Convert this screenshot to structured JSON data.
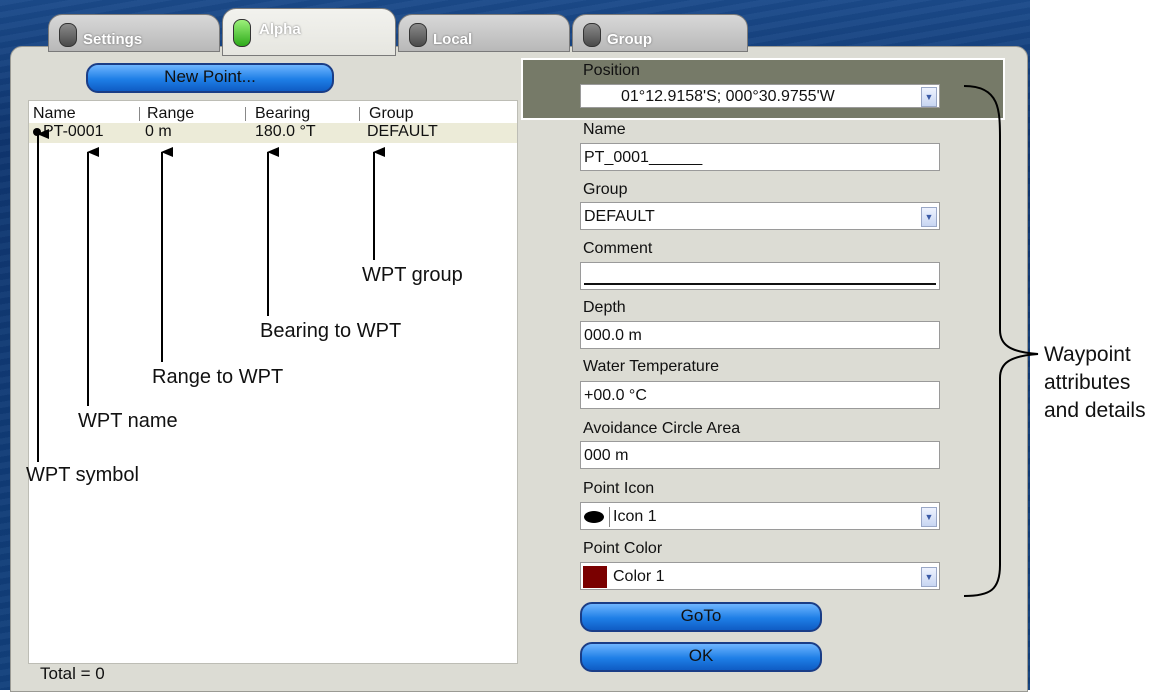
{
  "tabs": [
    {
      "label": "Settings"
    },
    {
      "label": "Alpha",
      "active": true
    },
    {
      "label": "Local"
    },
    {
      "label": "Group"
    }
  ],
  "left": {
    "new_point_button": "New Point...",
    "columns": [
      "Name",
      "Range",
      "Bearing",
      "Group"
    ],
    "rows": [
      {
        "name": "PT-0001",
        "range": "0 m",
        "bearing": "180.0 °T",
        "group": "DEFAULT"
      }
    ],
    "total": "Total = 0"
  },
  "annotations": {
    "wpt_group": "WPT group",
    "bearing_to_wpt": "Bearing to WPT",
    "range_to_wpt": "Range to WPT",
    "wpt_name": "WPT name",
    "wpt_symbol": "WPT symbol",
    "waypoint_attributes": [
      "Waypoint",
      "attributes",
      "and details"
    ]
  },
  "form": {
    "position": {
      "label": "Position",
      "value": "01°12.9158'S; 000°30.9755'W"
    },
    "name": {
      "label": "Name",
      "value": "PT_0001______"
    },
    "group": {
      "label": "Group",
      "value": "DEFAULT"
    },
    "comment": {
      "label": "Comment",
      "value": ""
    },
    "depth": {
      "label": "Depth",
      "value": "000.0 m"
    },
    "water_temperature": {
      "label": "Water Temperature",
      "value": "+00.0 °C"
    },
    "avoidance_circle_area": {
      "label": "Avoidance Circle Area",
      "value": "000 m"
    },
    "point_icon": {
      "label": "Point Icon",
      "value": "Icon 1",
      "icon": "filled-ellipse-icon"
    },
    "point_color": {
      "label": "Point Color",
      "value": "Color 1",
      "swatch": "#7a0000"
    },
    "goto_button": "GoTo",
    "ok_button": "OK"
  }
}
